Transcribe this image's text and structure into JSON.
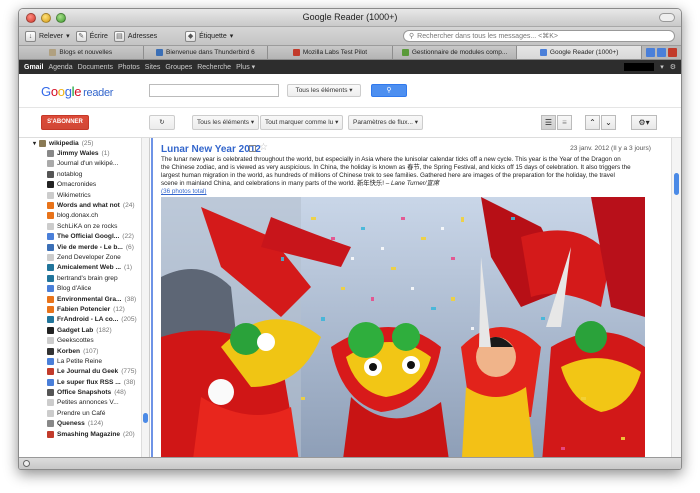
{
  "window": {
    "title": "Google Reader (1000+)"
  },
  "toolbar": {
    "items": [
      "Relever",
      "Écrire",
      "Adresses",
      "Étiquette"
    ],
    "search_placeholder": "Rechercher dans tous les messages... <⌘K>"
  },
  "tabs": [
    {
      "label": "Blogs et nouvelles",
      "color": "#b0a080"
    },
    {
      "label": "Bienvenue dans Thunderbird 6",
      "color": "#3b6fb6"
    },
    {
      "label": "Mozilla Labs Test Pilot",
      "color": "#c23b2b"
    },
    {
      "label": "Gestionnaire de modules comp...",
      "color": "#5a9a3a"
    },
    {
      "label": "Google Reader (1000+)",
      "color": "#4a7fd9"
    }
  ],
  "gbar": {
    "items": [
      "Gmail",
      "Agenda",
      "Documents",
      "Photos",
      "Sites",
      "Groupes",
      "Recherche",
      "Plus ▾"
    ]
  },
  "header": {
    "logo_google": "Google",
    "logo_reader": "reader",
    "search_scope": "Tous les éléments ▾",
    "search_icon": "search-icon"
  },
  "actions": {
    "subscribe": "S'ABONNER",
    "refresh_icon": "refresh-icon",
    "filter": "Tous les éléments ▾",
    "mark_read": "Tout marquer comme lu ▾",
    "feed_settings": "Paramètres de flux... ▾"
  },
  "sidebar": {
    "folder": {
      "name": "wikipedia",
      "count": "(25)"
    },
    "items": [
      {
        "name": "Jimmy Wales",
        "count": "(1)",
        "bold": true,
        "color": "#888"
      },
      {
        "name": "Journal d'un wikipé...",
        "count": "",
        "bold": false,
        "color": "#aaa"
      },
      {
        "name": "notablog",
        "count": "",
        "bold": false,
        "color": "#555"
      },
      {
        "name": "Omacronides",
        "count": "",
        "bold": false,
        "color": "#222"
      },
      {
        "name": "Wikimetrics",
        "count": "",
        "bold": false,
        "color": "#ccc"
      },
      {
        "name": "Words and what not",
        "count": "(24)",
        "bold": true,
        "color": "#e8731a"
      },
      {
        "name": "blog.donax.ch",
        "count": "",
        "bold": false,
        "color": "#e8731a"
      },
      {
        "name": "SchLiKA on ze rocks",
        "count": "",
        "bold": false,
        "color": "#ccc"
      },
      {
        "name": "The Official Googl...",
        "count": "(22)",
        "bold": true,
        "color": "#4a7fd9"
      },
      {
        "name": "Vie de merde - Le b...",
        "count": "(6)",
        "bold": true,
        "color": "#3b6fb6"
      },
      {
        "name": "Zend Developer Zone",
        "count": "",
        "bold": false,
        "color": "#ccc"
      },
      {
        "name": "Amicalement Web ...",
        "count": "(1)",
        "bold": true,
        "color": "#21759b"
      },
      {
        "name": "bertrand's brain grep",
        "count": "",
        "bold": false,
        "color": "#21759b"
      },
      {
        "name": "Blog d'Alice",
        "count": "",
        "bold": false,
        "color": "#4a7fd9"
      },
      {
        "name": "Environmental Gra...",
        "count": "(38)",
        "bold": true,
        "color": "#e8731a"
      },
      {
        "name": "Fabien Potencier",
        "count": "(12)",
        "bold": true,
        "color": "#e8731a"
      },
      {
        "name": "FrAndroid - LA co...",
        "count": "(205)",
        "bold": true,
        "color": "#21759b"
      },
      {
        "name": "Gadget Lab",
        "count": "(182)",
        "bold": true,
        "color": "#222"
      },
      {
        "name": "Geekscottes",
        "count": "",
        "bold": false,
        "color": "#ccc"
      },
      {
        "name": "Korben",
        "count": "(107)",
        "bold": true,
        "color": "#333"
      },
      {
        "name": "La Petite Reine",
        "count": "",
        "bold": false,
        "color": "#4a7fd9"
      },
      {
        "name": "Le Journal du Geek",
        "count": "(775)",
        "bold": true,
        "color": "#c23b2b"
      },
      {
        "name": "Le super flux RSS ...",
        "count": "(38)",
        "bold": true,
        "color": "#4a7fd9"
      },
      {
        "name": "Office Snapshots",
        "count": "(48)",
        "bold": true,
        "color": "#555"
      },
      {
        "name": "Petites annonces V...",
        "count": "",
        "bold": false,
        "color": "#ccc"
      },
      {
        "name": "Prendre un Café",
        "count": "",
        "bold": false,
        "color": "#ccc"
      },
      {
        "name": "Queness",
        "count": "(124)",
        "bold": true,
        "color": "#888"
      },
      {
        "name": "Smashing Magazine",
        "count": "(20)",
        "bold": true,
        "color": "#c23b2b"
      }
    ]
  },
  "entry": {
    "title": "Lunar New Year 2012",
    "date": "23 janv. 2012 (Il y a 3 jours)",
    "body": "The lunar new year is celebrated throughout the world, but especially in Asia where the lunisolar calendar ticks off a new cycle. This year is the Year of the Dragon on the Chinese zodiac, and is viewed as very auspicious. In China, the holiday is known as 春节, the Spring Festival, and kicks off 15 days of celebration. It also triggers the largest human migration in the world, as hundreds of millions of Chinese trek to see families. Gathered here are images of the preparation for the holiday, the travel scene in mainland China, and celebrations in many parts of the world. 新年快乐! – ",
    "author": "Lane Turner/",
    "author_cjk": "宣席",
    "photos_link": "(36 photos total)"
  }
}
